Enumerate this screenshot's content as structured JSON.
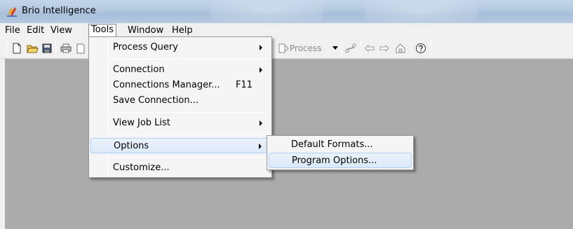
{
  "window": {
    "title": "Brio Intelligence",
    "icon": "brio-app-icon"
  },
  "menubar": {
    "items": [
      {
        "label": "File"
      },
      {
        "label": "Edit"
      },
      {
        "label": "View"
      },
      {
        "label": "Tools",
        "open": true
      },
      {
        "label": "Window"
      },
      {
        "label": "Help"
      }
    ]
  },
  "toolbar": {
    "process_label": "Process",
    "icons": [
      "new-icon",
      "open-folder-icon",
      "save-icon",
      "print-icon",
      "print-preview-icon",
      "process-icon",
      "dropdown-arrow-icon",
      "connection-icon",
      "back-arrow-icon",
      "forward-arrow-icon",
      "home-icon",
      "help-icon"
    ]
  },
  "tools_menu": {
    "items": [
      {
        "label": "Process Query",
        "submenu": true
      },
      {
        "label": "Connection",
        "submenu": true
      },
      {
        "label": "Connections Manager...",
        "shortcut": "F11"
      },
      {
        "label": "Save Connection..."
      },
      {
        "label": "View Job List",
        "submenu": true
      },
      {
        "label": "Options",
        "submenu": true,
        "highlighted": true
      },
      {
        "label": "Customize..."
      }
    ]
  },
  "options_submenu": {
    "items": [
      {
        "label": "Default Formats..."
      },
      {
        "label": "Program Options...",
        "highlighted": true
      }
    ]
  },
  "colors": {
    "workspace": "#ababab",
    "highlight_border": "#aecff7",
    "highlight_fill": "#dce9f8"
  }
}
